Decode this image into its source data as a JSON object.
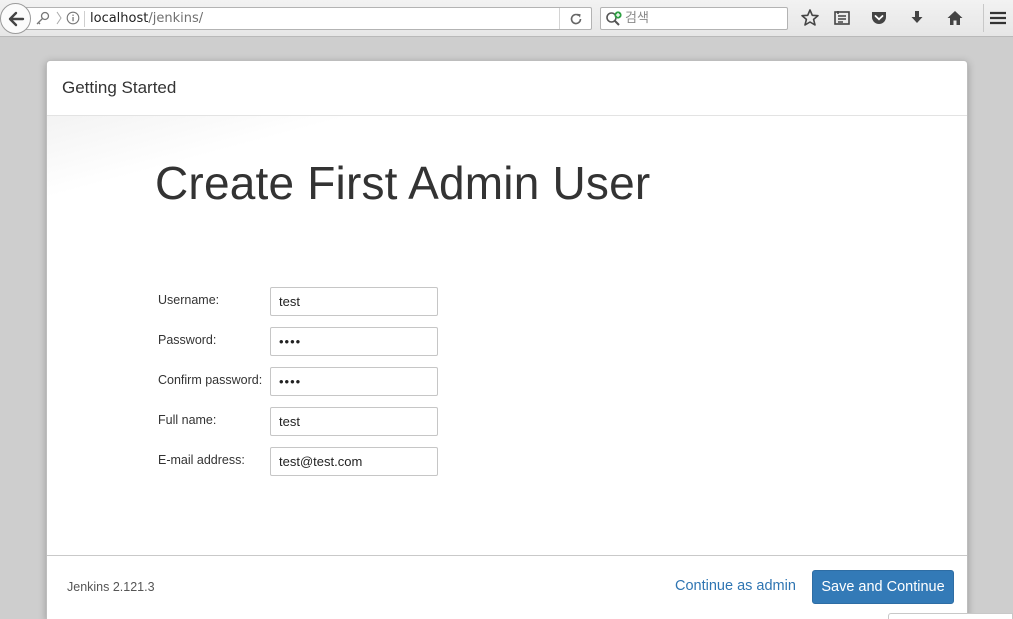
{
  "browser": {
    "url_host": "localhost",
    "url_path": "/jenkins/",
    "search_placeholder": "검색"
  },
  "dialog": {
    "header_title": "Getting Started",
    "heading": "Create First Admin User",
    "fields": [
      {
        "label": "Username:",
        "value": "test",
        "type": "text"
      },
      {
        "label": "Password:",
        "value": "test",
        "type": "password"
      },
      {
        "label": "Confirm password:",
        "value": "test",
        "type": "password"
      },
      {
        "label": "Full name:",
        "value": "test",
        "type": "text"
      },
      {
        "label": "E-mail address:",
        "value": "test@test.com",
        "type": "text"
      }
    ],
    "footer": {
      "version": "Jenkins 2.121.3",
      "continue_link": "Continue as admin",
      "save_button": "Save and Continue"
    }
  },
  "colors": {
    "primary_button": "#337ab7",
    "link": "#2f75b2",
    "page_background": "#cecece"
  }
}
